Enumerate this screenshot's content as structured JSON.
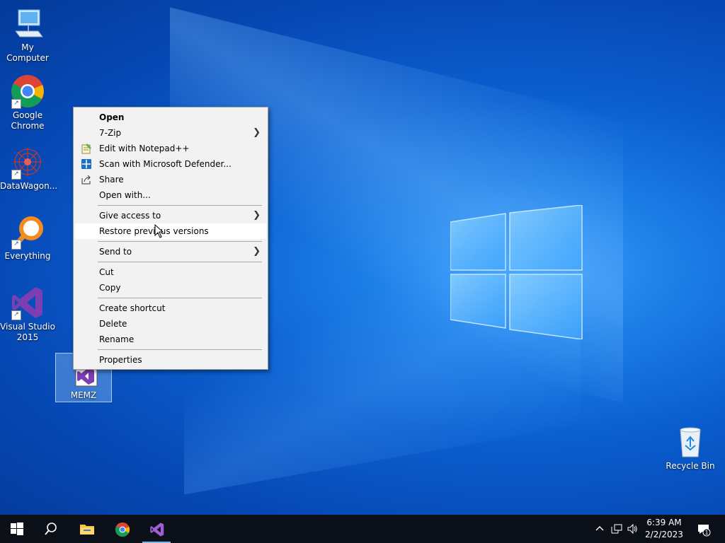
{
  "desktop_icons": {
    "my_computer": "My Computer",
    "chrome": "Google Chrome",
    "datawagon": "DataWagon...",
    "everything": "Everything",
    "visual_studio": "Visual Studio 2015",
    "memz": "MEMZ",
    "recycle_bin": "Recycle Bin"
  },
  "context_menu": {
    "items": [
      {
        "label": "Open"
      },
      {
        "label": "7-Zip"
      },
      {
        "label": "Edit with Notepad++"
      },
      {
        "label": "Scan with Microsoft Defender..."
      },
      {
        "label": "Share"
      },
      {
        "label": "Open with..."
      },
      {
        "label": "Give access to"
      },
      {
        "label": "Restore previous versions"
      },
      {
        "label": "Send to"
      },
      {
        "label": "Cut"
      },
      {
        "label": "Copy"
      },
      {
        "label": "Create shortcut"
      },
      {
        "label": "Delete"
      },
      {
        "label": "Rename"
      },
      {
        "label": "Properties"
      }
    ]
  },
  "taskbar": {
    "clock_time": "6:39 AM",
    "clock_date": "2/2/2023",
    "notification_count": "1"
  },
  "colors": {
    "accent": "#0078d7",
    "taskbar": "#0b1018",
    "menu_bg": "#f2f2f2"
  }
}
